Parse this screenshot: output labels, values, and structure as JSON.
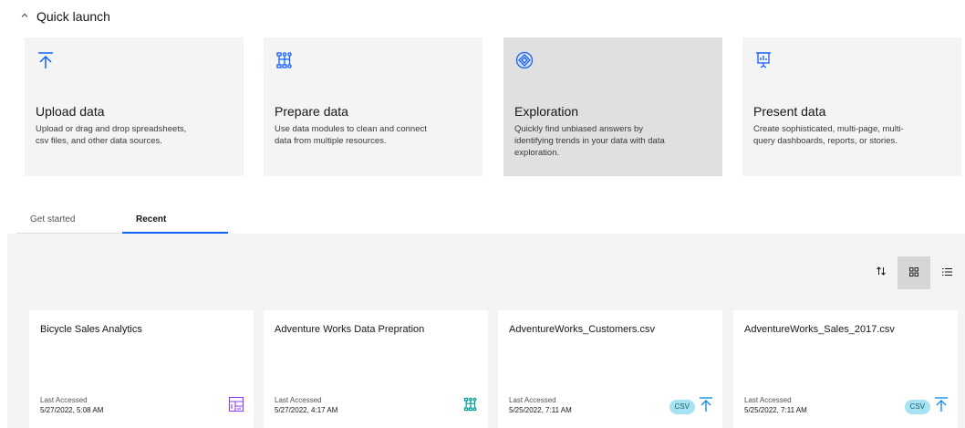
{
  "quick_launch": {
    "title": "Quick launch",
    "tiles": [
      {
        "title": "Upload data",
        "description": "Upload or drag and drop spreadsheets, csv files, and other data sources.",
        "icon": "upload-icon"
      },
      {
        "title": "Prepare data",
        "description": "Use data modules to clean and connect data from multiple resources.",
        "icon": "data-module-icon"
      },
      {
        "title": "Exploration",
        "description": "Quickly find unbiased answers by identifying trends in your data with data exploration.",
        "icon": "exploration-icon"
      },
      {
        "title": "Present data",
        "description": "Create sophisticated, multi-page, multi-query dashboards, reports, or stories.",
        "icon": "presentation-icon"
      }
    ]
  },
  "tabs": [
    {
      "label": "Get started"
    },
    {
      "label": "Recent"
    }
  ],
  "toolbar": {
    "sort_icon": "sort-icon",
    "grid_icon": "grid-view-icon",
    "list_icon": "list-view-icon"
  },
  "recent": {
    "items": [
      {
        "title": "Bicycle Sales Analytics",
        "accessed_label": "Last Accessed",
        "accessed_date": "5/27/2022, 5:08 AM",
        "icon": "dashboard-icon"
      },
      {
        "title": "Adventure Works Data Prepration",
        "accessed_label": "Last Accessed",
        "accessed_date": "5/27/2022, 4:17 AM",
        "icon": "data-module-icon"
      },
      {
        "title": "AdventureWorks_Customers.csv",
        "accessed_label": "Last Accessed",
        "accessed_date": "5/25/2022, 7:11 AM",
        "badge": "CSV",
        "icon": "upload-icon"
      },
      {
        "title": "AdventureWorks_Sales_2017.csv",
        "accessed_label": "Last Accessed",
        "accessed_date": "5/25/2022, 7:11 AM",
        "badge": "CSV",
        "icon": "upload-icon"
      }
    ]
  },
  "colors": {
    "accent": "#0f62fe",
    "dashboard_icon": "#8a3ffc",
    "module_icon": "#009d9a",
    "upload_icon": "#1192e8",
    "csv_badge": "#a6e2f1"
  }
}
